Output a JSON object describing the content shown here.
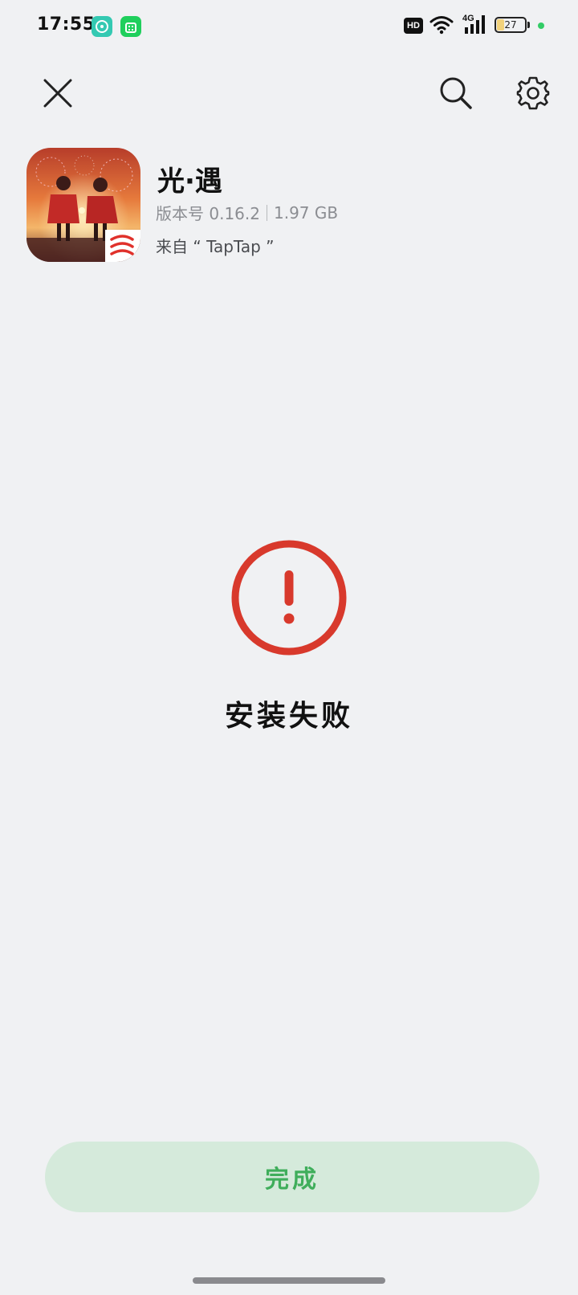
{
  "status_bar": {
    "time": "17:55",
    "network_badge": "HD",
    "network_type": "4G",
    "battery_level": "27",
    "battery_fraction": 0.27,
    "icons": [
      "notification-app-icon",
      "notification-store-icon",
      "hd-icon",
      "wifi-icon",
      "signal-icon",
      "battery-icon"
    ]
  },
  "toolbar": {
    "close_icon": "close-icon",
    "search_icon": "search-icon",
    "settings_icon": "gear-icon"
  },
  "app": {
    "name": "光·遇",
    "version": "版本号 0.16.2",
    "size": "1.97 GB",
    "source": "来自 “ TapTap ”"
  },
  "result": {
    "status_icon": "error-icon",
    "message": "安装失败"
  },
  "actions": {
    "done_label": "完成"
  },
  "colors": {
    "background": "#f0f1f3",
    "error_red": "#d8392c",
    "done_button_bg": "#d5eadb",
    "done_button_text": "#3fae5b"
  }
}
